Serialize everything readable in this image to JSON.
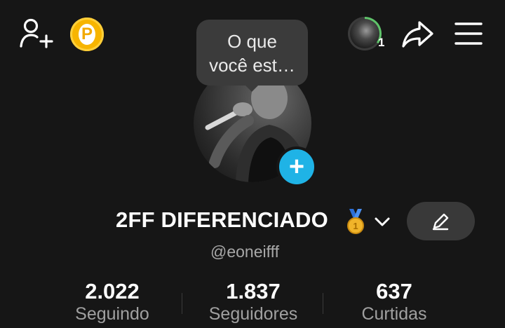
{
  "topbar": {
    "add_user_icon": "add-user-icon",
    "coin_label": "P",
    "coin_color": "#f7b500",
    "friend_count": "1",
    "share_icon": "share-arrow-icon",
    "menu_icon": "hamburger-menu-icon"
  },
  "status_bubble": {
    "line1": "O que",
    "line2": "você est…"
  },
  "profile": {
    "add_photo_color": "#1fb3e6",
    "display_name": "2FF DIFERENCIADO",
    "badge_icon": "gold-medal-icon",
    "handle": "@eoneifff",
    "edit_icon": "pencil-icon"
  },
  "stats": [
    {
      "value": "2.022",
      "label": "Seguindo"
    },
    {
      "value": "1.837",
      "label": "Seguidores"
    },
    {
      "value": "637",
      "label": "Curtidas"
    }
  ]
}
